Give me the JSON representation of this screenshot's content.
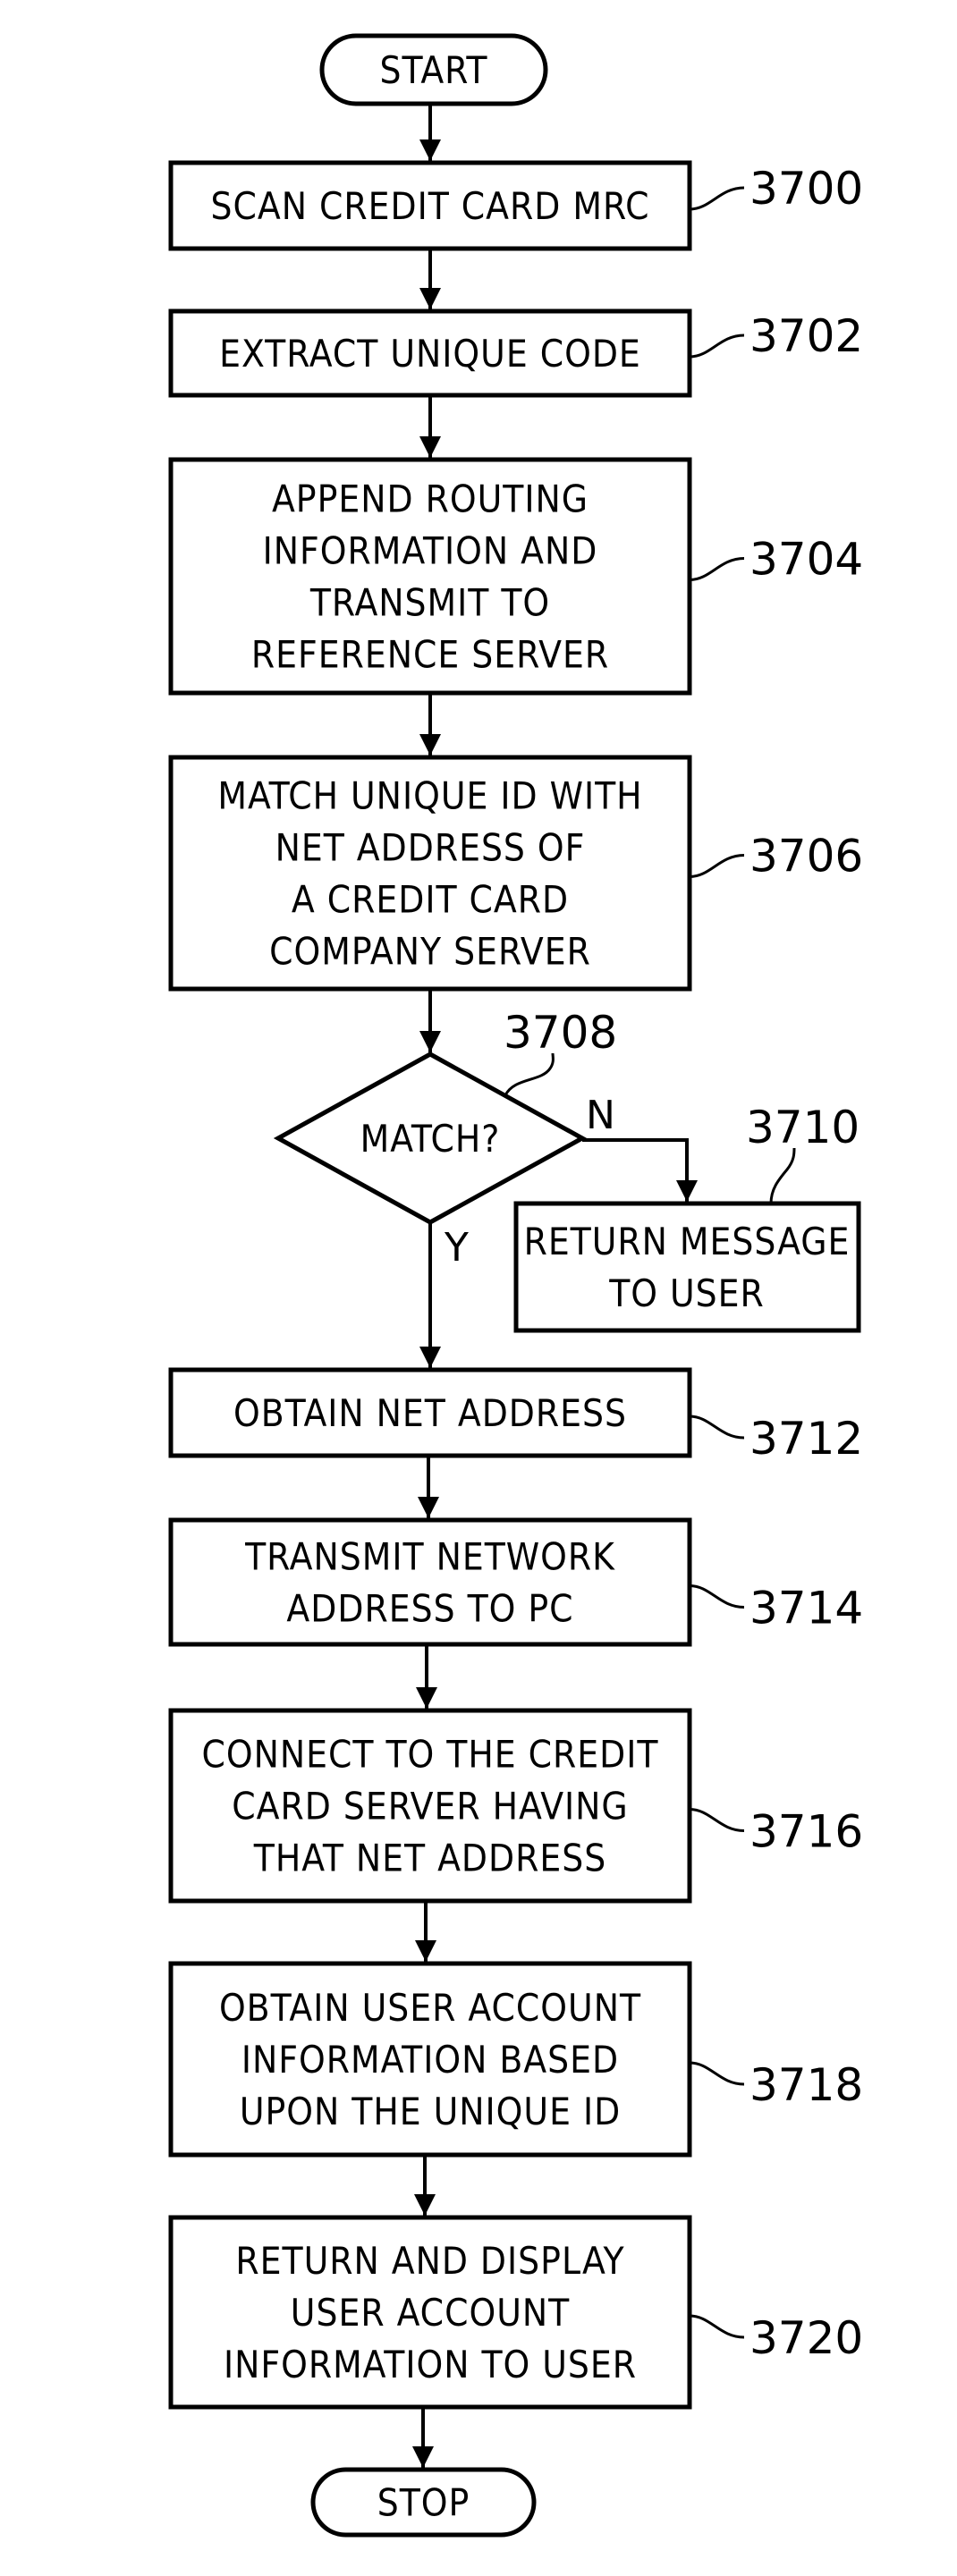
{
  "figure": {
    "type": "flowchart",
    "terminals": {
      "start": "START",
      "stop": "STOP"
    },
    "steps": [
      {
        "id": "3700",
        "lines": [
          "SCAN CREDIT CARD MRC"
        ]
      },
      {
        "id": "3702",
        "lines": [
          "EXTRACT UNIQUE CODE"
        ]
      },
      {
        "id": "3704",
        "lines": [
          "APPEND ROUTING",
          "INFORMATION AND",
          "TRANSMIT TO",
          "REFERENCE SERVER"
        ]
      },
      {
        "id": "3706",
        "lines": [
          "MATCH UNIQUE ID WITH",
          "NET ADDRESS OF",
          "A CREDIT CARD",
          "COMPANY SERVER"
        ]
      },
      {
        "id": "3712",
        "lines": [
          "OBTAIN NET ADDRESS"
        ]
      },
      {
        "id": "3714",
        "lines": [
          "TRANSMIT NETWORK",
          "ADDRESS TO PC"
        ]
      },
      {
        "id": "3716",
        "lines": [
          "CONNECT TO THE CREDIT",
          "CARD SERVER HAVING",
          "THAT NET ADDRESS"
        ]
      },
      {
        "id": "3718",
        "lines": [
          "OBTAIN USER ACCOUNT",
          "INFORMATION BASED",
          "UPON THE UNIQUE ID"
        ]
      },
      {
        "id": "3720",
        "lines": [
          "RETURN AND DISPLAY",
          "USER ACCOUNT",
          "INFORMATION TO USER"
        ]
      }
    ],
    "decision": {
      "id": "3708",
      "label": "MATCH?",
      "yes_label": "Y",
      "no_label": "N"
    },
    "no_branch": {
      "id": "3710",
      "lines": [
        "RETURN MESSAGE",
        "TO USER"
      ]
    }
  }
}
